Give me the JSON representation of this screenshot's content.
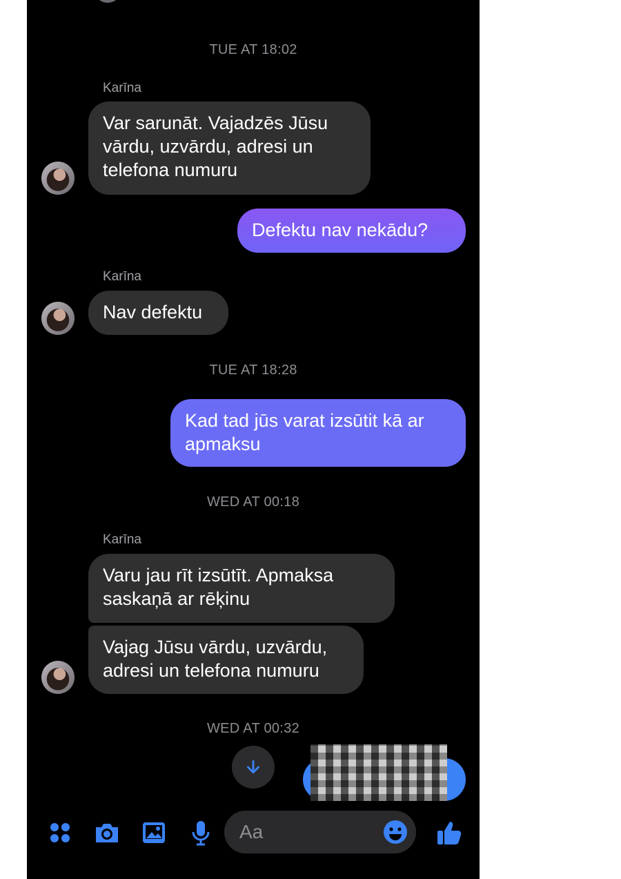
{
  "colors": {
    "background": "#000000",
    "incoming_bubble": "#303030",
    "outgoing_bubble": "#8957f2",
    "accent": "#3b82f6",
    "timestamp": "#8e8e93"
  },
  "timestamps": [
    "TUE AT 18:02",
    "TUE AT 18:28",
    "WED AT 00:18",
    "WED AT 00:32"
  ],
  "sender_name": "Karīna",
  "messages": {
    "m1": "Var sarunāt. Vajadzēs Jūsu\nvārdu, uzvārdu, adresi un\ntelefona numuru",
    "m2": "Defektu  nav nekādu?",
    "m3": "Nav defektu",
    "m4": "Kad tad jūs varat izsūtit kā ar\napmaksu",
    "m5": "Varu jau rīt izsūtīt. Apmaksa\nsaskaņā ar rēķinu",
    "m6": "Vajag Jūsu vārdu, uzvārdu,\nadresi un telefona numuru"
  },
  "composer": {
    "placeholder": "Aa",
    "icons": [
      "apps-icon",
      "camera-icon",
      "gallery-icon",
      "microphone-icon",
      "emoji-icon",
      "thumbs-up-icon"
    ]
  }
}
